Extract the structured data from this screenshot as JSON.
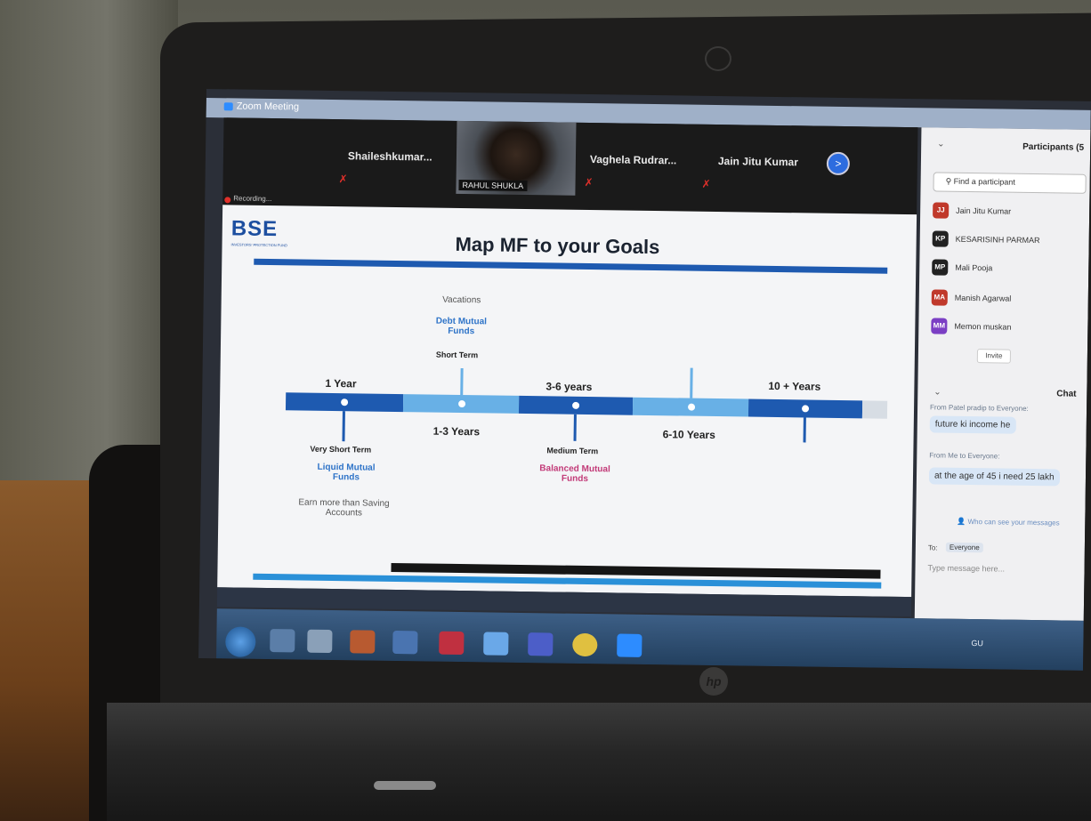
{
  "zoom": {
    "window_title": "Zoom Meeting",
    "recording_label": "Recording...",
    "video_tiles": [
      {
        "name": "Shaileshkumar..."
      },
      {
        "name": "RAHUL SHUKLA"
      },
      {
        "name": "Vaghela Rudrar..."
      },
      {
        "name": "Jain Jitu Kumar"
      }
    ],
    "next_arrow": ">"
  },
  "slide": {
    "logo_text": "BSE",
    "logo_subtext": "INVESTORS' PROTECTION FUND",
    "title": "Map MF to your Goals",
    "timeline": {
      "above": [
        {
          "period": "1 Year"
        },
        {
          "period": "3-6 years"
        },
        {
          "period": "10 + Years"
        }
      ],
      "below": [
        {
          "period": "1-3 Years"
        },
        {
          "period": "6-10 Years"
        }
      ]
    },
    "vacations": {
      "goal": "Vacations",
      "fund": "Debt Mutual Funds",
      "term": "Short Term"
    },
    "very_short": {
      "term": "Very Short Term",
      "fund": "Liquid Mutual Funds",
      "note": "Earn more than Saving Accounts"
    },
    "medium": {
      "term": "Medium Term",
      "fund": "Balanced Mutual Funds"
    }
  },
  "participants": {
    "header": "Participants (5",
    "search_placeholder": "Find a participant",
    "list": [
      {
        "initials": "JJ",
        "name": "Jain Jitu Kumar",
        "color": "#c0392b"
      },
      {
        "initials": "KP",
        "name": "KESARISINH PARMAR",
        "color": "#222222"
      },
      {
        "initials": "MP",
        "name": "Mali Pooja",
        "color": "#222222"
      },
      {
        "initials": "MA",
        "name": "Manish Agarwal",
        "color": "#c0392b"
      },
      {
        "initials": "MM",
        "name": "Memon muskan",
        "color": "#7b3fc4"
      }
    ],
    "invite_label": "Invite"
  },
  "chat": {
    "header": "Chat",
    "messages": [
      {
        "meta": "From Patel pradip to Everyone:",
        "text": "future ki income he"
      },
      {
        "meta": "From Me to Everyone:",
        "text": "at the age of 45 i need 25 lakh"
      }
    ],
    "who_can_see": "Who can see your messages",
    "to_label": "To:",
    "to_value": "Everyone",
    "input_placeholder": "Type message here..."
  },
  "taskbar": {
    "tray_text": "GU"
  },
  "laptop": {
    "brand": "hp"
  }
}
